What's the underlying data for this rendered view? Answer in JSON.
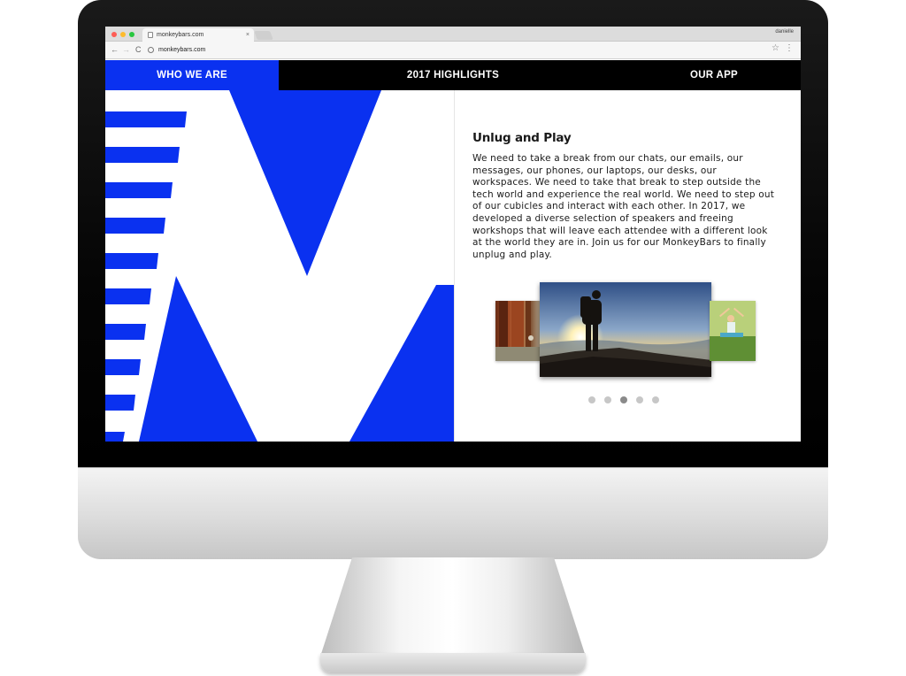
{
  "browser": {
    "tab_title": "monkeybars.com",
    "tab_close": "×",
    "profile": "danielle",
    "url": "monkeybars.com",
    "back_glyph": "←",
    "forward_glyph": "→",
    "reload_glyph": "C",
    "star_glyph": "☆",
    "menu_glyph": "⋮"
  },
  "nav": {
    "items": [
      {
        "label": "WHO WE ARE",
        "active": true
      },
      {
        "label": "2017 HIGHLIGHTS",
        "active": false
      },
      {
        "label": "OUR APP",
        "active": false
      }
    ]
  },
  "content": {
    "title": "Unlug and Play",
    "body": "We need to take a break from our chats, our emails, our messages, our phones, our laptops, our desks, our workspaces. We need to take that break to step outside the tech world and experience the real world. We need to step out of our cubicles and interact with each other. In 2017, we developed a diverse selection of speakers and freeing workshops that will leave each attendee with a different look at the world they are in. Join us for our MonkeyBars to finally unplug and play."
  },
  "carousel": {
    "slide_count": 5,
    "active_index": 2,
    "slides": [
      "redwood-forest-photo",
      "hiker-on-rock-sunset-photo",
      "yoga-in-park-photo"
    ]
  },
  "colors": {
    "brand_blue": "#0a31f0",
    "nav_background": "#000000",
    "text": "#1a1a1a"
  }
}
